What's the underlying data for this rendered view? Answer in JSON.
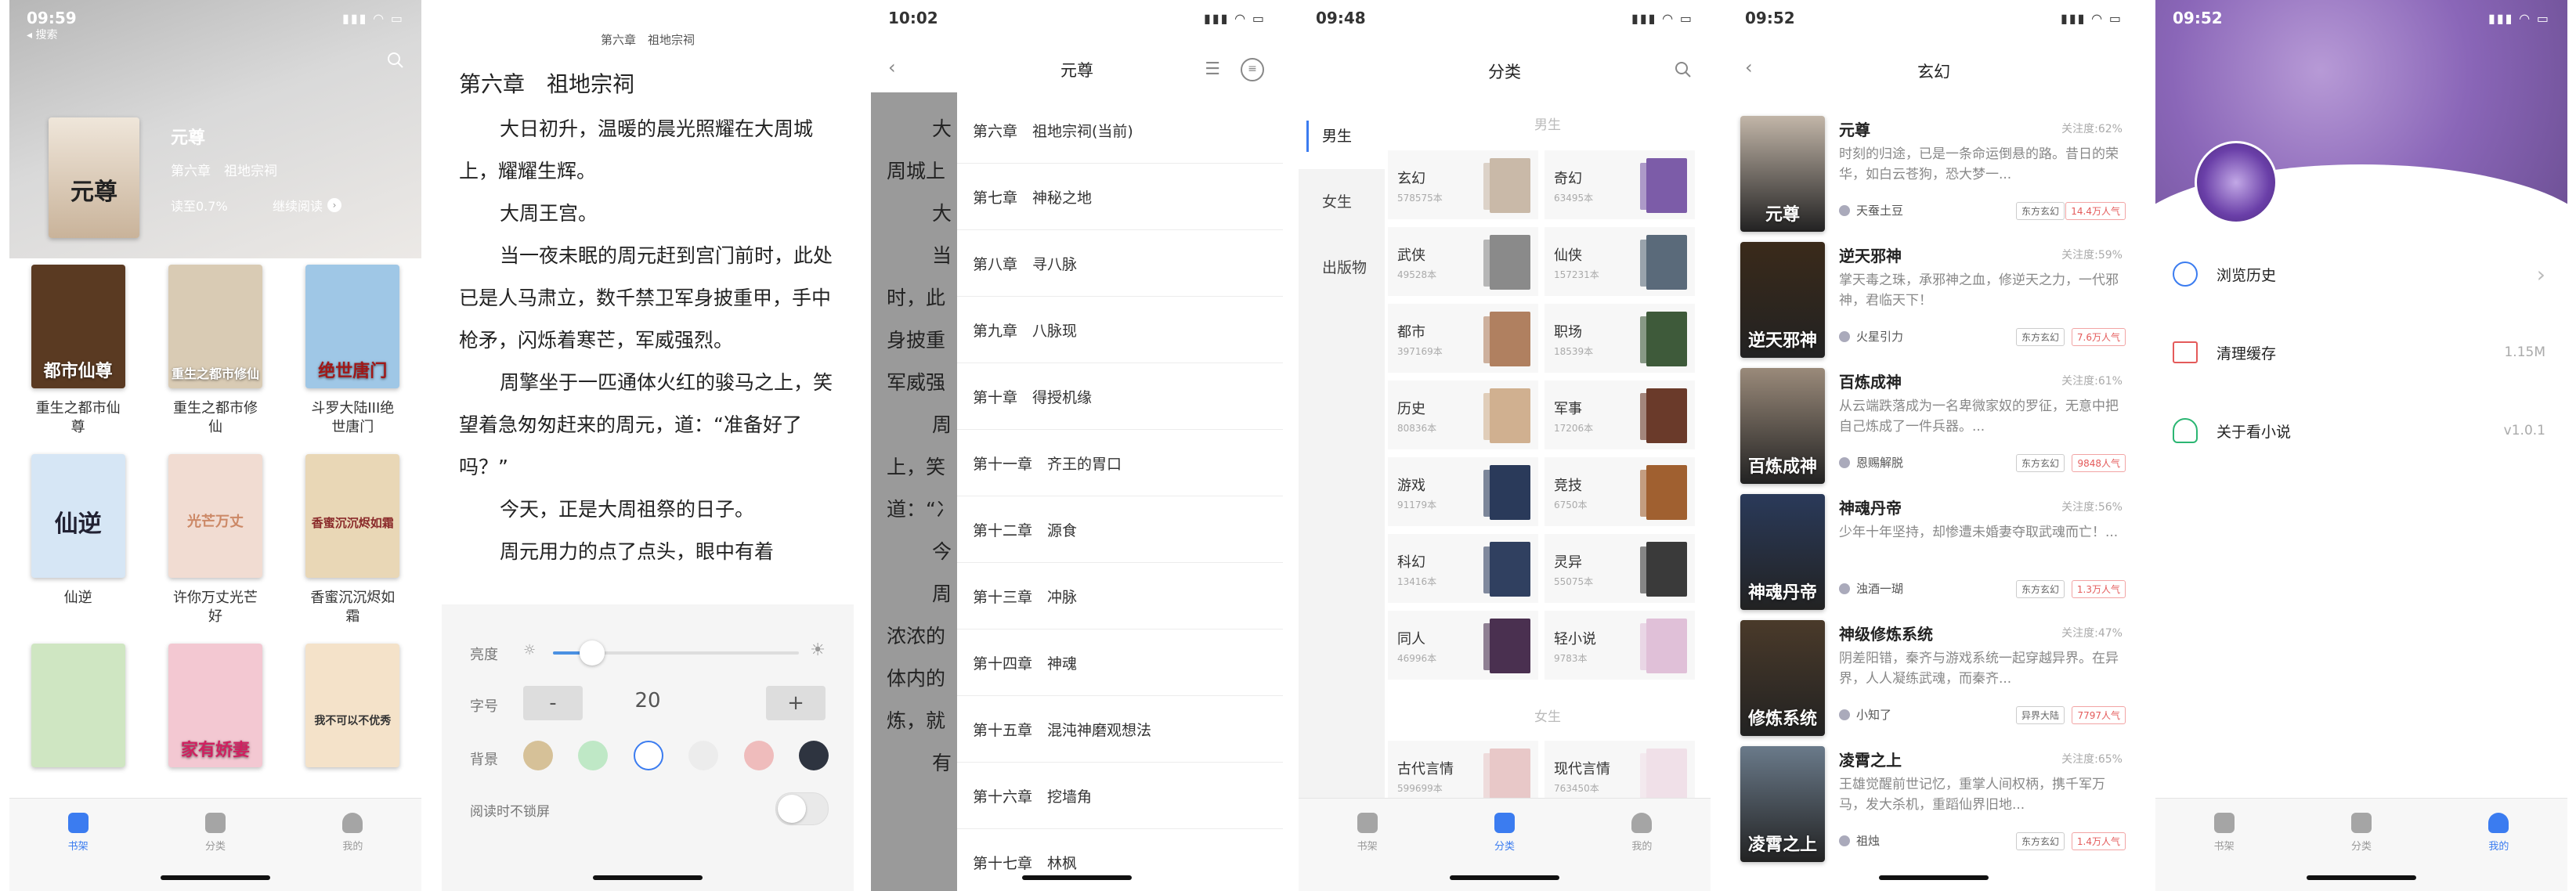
{
  "screen1": {
    "status": {
      "time": "09:59",
      "back_label": "◂ 搜索"
    },
    "current": {
      "title": "元尊",
      "chapter": "第六章　祖地宗祠",
      "progress": "读至0.7%",
      "continue_label": "继续阅读"
    },
    "books": [
      {
        "title": "重生之都市仙尊",
        "cover_text": "都市仙尊",
        "color": "#5a3a22"
      },
      {
        "title": "重生之都市修仙",
        "cover_text": "重生之都市修仙",
        "color": "#d9cbb4"
      },
      {
        "title": "斗罗大陆III绝世唐门",
        "cover_text": "绝世唐门",
        "color": "#9fc7e6"
      },
      {
        "title": "仙逆",
        "cover_text": "仙逆",
        "color": "#d6e6f5"
      },
      {
        "title": "许你万丈光芒好",
        "cover_text": "光芒万丈",
        "color": "#f1dcd2"
      },
      {
        "title": "香蜜沉沉烬如霜",
        "cover_text": "香蜜沉沉烬如霜",
        "color": "#e9d7b6"
      },
      {
        "title": "",
        "cover_text": "",
        "color": "#cfe6c2"
      },
      {
        "title": "",
        "cover_text": "家有娇妻",
        "color": "#f3c8d2"
      },
      {
        "title": "",
        "cover_text": "我不可以不优秀",
        "color": "#f4e2c9"
      }
    ],
    "tabs": [
      {
        "label": "书架"
      },
      {
        "label": "分类"
      },
      {
        "label": "我的"
      }
    ]
  },
  "screen2": {
    "header": "第六章　祖地宗祠",
    "chapter_title": "第六章　祖地宗祠",
    "paragraphs": [
      "大日初升，温暖的晨光照耀在大周城上，耀耀生辉。",
      "大周王宫。",
      "当一夜未眠的周元赶到宫门前时，此处已是人马肃立，数千禁卫军身披重甲，手中枪矛，闪烁着寒芒，军威强烈。",
      "周擎坐于一匹通体火红的骏马之上，笑望着急匆匆赶来的周元，道：“准备好了吗？”",
      "今天，正是大周祖祭的日子。",
      "周元用力的点了点头，眼中有着"
    ],
    "settings": {
      "brightness_label": "亮度",
      "brightness_level": 0.16,
      "font_label": "字号",
      "font_minus": "-",
      "font_size": "20",
      "font_plus": "+",
      "bg_label": "背景",
      "bg_colors": [
        "#d6c198",
        "#bfe8c6",
        "#ffffff",
        "#ececec",
        "#efbcbc",
        "#2e3440"
      ],
      "lock_label": "阅读时不锁屏"
    }
  },
  "screen3": {
    "status": {
      "time": "10:02"
    },
    "title": "元尊",
    "bg_text": [
      "大",
      "周城上",
      "大",
      "当",
      "时，此",
      "身披重",
      "军威强",
      "周",
      "上，笑",
      "道：“冫",
      "今",
      "周",
      "浓浓的",
      "体内的",
      "炼，就",
      "有"
    ],
    "chapters": [
      "第六章　祖地宗祠(当前)",
      "第七章　神秘之地",
      "第八章　寻八脉",
      "第九章　八脉现",
      "第十章　得授机缘",
      "第十一章　齐王的胃口",
      "第十二章　源食",
      "第十三章　冲脉",
      "第十四章　神魂",
      "第十五章　混沌神磨观想法",
      "第十六章　挖墙角",
      "第十七章　林枫"
    ]
  },
  "screen4": {
    "status": {
      "time": "09:48"
    },
    "title": "分类",
    "side": [
      {
        "label": "男生"
      },
      {
        "label": "女生"
      },
      {
        "label": "出版物"
      }
    ],
    "male_header": "男生",
    "female_header": "女生",
    "male": [
      {
        "name": "玄幻",
        "count": "578575本",
        "color": "#c9b9a8"
      },
      {
        "name": "奇幻",
        "count": "63495本",
        "color": "#7c5ca8"
      },
      {
        "name": "武侠",
        "count": "49528本",
        "color": "#8a8a8a"
      },
      {
        "name": "仙侠",
        "count": "157231本",
        "color": "#5a6a7a"
      },
      {
        "name": "都市",
        "count": "397169本",
        "color": "#b08060"
      },
      {
        "name": "职场",
        "count": "18539本",
        "color": "#3e5a3a"
      },
      {
        "name": "历史",
        "count": "80836本",
        "color": "#d0b090"
      },
      {
        "name": "军事",
        "count": "17206本",
        "color": "#6a3a2a"
      },
      {
        "name": "游戏",
        "count": "91179本",
        "color": "#2a3a5a"
      },
      {
        "name": "竞技",
        "count": "6750本",
        "color": "#a06030"
      },
      {
        "name": "科幻",
        "count": "13416本",
        "color": "#304060"
      },
      {
        "name": "灵异",
        "count": "55075本",
        "color": "#3a3a3a"
      },
      {
        "name": "同人",
        "count": "46996本",
        "color": "#4a3050"
      },
      {
        "name": "轻小说",
        "count": "9783本",
        "color": "#e0c0d8"
      }
    ],
    "female": [
      {
        "name": "古代言情",
        "count": "599699本",
        "color": "#e8c8c8"
      },
      {
        "name": "现代言情",
        "count": "763450本",
        "color": "#f0e0e8"
      }
    ],
    "tabs": [
      {
        "label": "书架"
      },
      {
        "label": "分类"
      },
      {
        "label": "我的"
      }
    ]
  },
  "screen5": {
    "status": {
      "time": "09:52"
    },
    "title": "玄幻",
    "books": [
      {
        "name": "元尊",
        "follow": "关注度:62%",
        "desc": "时刻的归途，已是一条命运倒悬的路。昔日的荣华，如白云苍狗，恐大梦一...",
        "author": "天蚕土豆",
        "tag": "东方玄幻",
        "pop": "14.4万人气",
        "color": "#c2b6a8",
        "cover_text": "元尊"
      },
      {
        "name": "逆天邪神",
        "follow": "关注度:59%",
        "desc": "掌天毒之珠，承邪神之血，修逆天之力，一代邪神，君临天下！",
        "author": "火星引力",
        "tag": "东方玄幻",
        "pop": "7.6万人气",
        "color": "#3a2a1a",
        "cover_text": "逆天邪神"
      },
      {
        "name": "百炼成神",
        "follow": "关注度:61%",
        "desc": "从云端跌落成为一名卑微家奴的罗征，无意中把自己炼成了一件兵器。...",
        "author": "恩赐解脱",
        "tag": "东方玄幻",
        "pop": "9848人气",
        "color": "#9a8a7a",
        "cover_text": "百炼成神"
      },
      {
        "name": "神魂丹帝",
        "follow": "关注度:56%",
        "desc": "少年十年坚持，却惨遭未婚妻夺取武魂而亡！...",
        "author": "浊酒一瑚",
        "tag": "东方玄幻",
        "pop": "1.3万人气",
        "color": "#2a3a5a",
        "cover_text": "神魂丹帝"
      },
      {
        "name": "神级修炼系统",
        "follow": "关注度:47%",
        "desc": "阴差阳错，秦齐与游戏系统一起穿越异界。在异界，人人凝练武魂，而秦齐...",
        "author": "小知了",
        "tag": "异界大陆",
        "pop": "7797人气",
        "color": "#4a3a2a",
        "cover_text": "修炼系统"
      },
      {
        "name": "凌霄之上",
        "follow": "关注度:65%",
        "desc": "王雄觉醒前世记忆，重掌人间权柄，携千军万马，发大杀机，重蹈仙界旧地...",
        "author": "祖烛",
        "tag": "东方玄幻",
        "pop": "1.4万人气",
        "color": "#6a7a8a",
        "cover_text": "凌霄之上"
      }
    ]
  },
  "screen6": {
    "status": {
      "time": "09:52"
    },
    "menu": [
      {
        "label": "浏览历史",
        "value": "›"
      },
      {
        "label": "清理缓存",
        "value": "1.15M"
      },
      {
        "label": "关于看小说",
        "value": "v1.0.1"
      }
    ],
    "tabs": [
      {
        "label": "书架"
      },
      {
        "label": "分类"
      },
      {
        "label": "我的"
      }
    ]
  },
  "colors": {
    "accent": "#3b7cf0",
    "sidebar_active": "#3b7cf0",
    "hot": "#e45a5a"
  }
}
